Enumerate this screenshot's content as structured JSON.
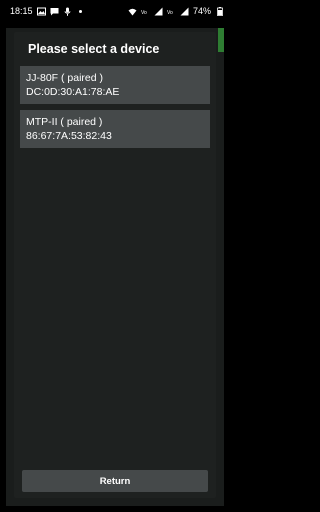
{
  "status_bar": {
    "time": "18:15",
    "battery": "74%",
    "left_icons": [
      "image-icon",
      "message-icon",
      "mic-icon",
      "dot-icon"
    ],
    "right_icons": [
      "wifi-icon",
      "volte-icon",
      "signal-icon",
      "volte-icon",
      "signal-icon",
      "battery-icon"
    ]
  },
  "dialog": {
    "title": "Please select a device",
    "devices": [
      {
        "name": "JJ-80F ( paired )",
        "address": "DC:0D:30:A1:78:AE"
      },
      {
        "name": "MTP-II ( paired )",
        "address": "86:67:7A:53:82:43"
      }
    ],
    "return_label": "Return"
  },
  "colors": {
    "background": "#000000",
    "dialog": "#1e2120",
    "item": "#45494a",
    "accent": "#2e7d32"
  }
}
